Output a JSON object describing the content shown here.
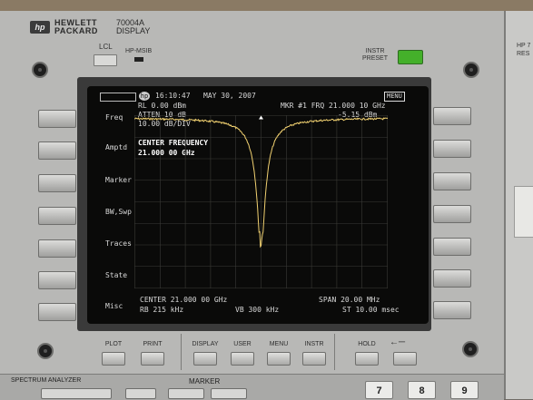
{
  "instrument": {
    "brand_line1": "HEWLETT",
    "brand_line2": "PACKARD",
    "model": "70004A",
    "model_sub": "DISPLAY",
    "hp_logo": "hp",
    "lcl_label": "LCL",
    "hpmsib_label": "HP-MSIB",
    "instr_label_1": "INSTR",
    "instr_label_2": "PRESET",
    "preset_color": "#44b02a",
    "right_unit_label_1": "HP 7",
    "right_unit_label_2": "RES"
  },
  "screen": {
    "hp_glyph": "hp",
    "time": "16:10:47",
    "date": "MAY 30, 2007",
    "menu": "MENU",
    "rl": "RL 0.00 dBm",
    "atten": "ATTEN 10 dB",
    "scale": "10.00 dB/DIV",
    "marker_line": "MKR #1 FRQ 21.000 10 GHz",
    "marker_level": "-5.15 dBm",
    "active_label": "CENTER FREQUENCY",
    "active_value": "21.000 00 GHz",
    "center": "CENTER 21.000 00 GHz",
    "span": "SPAN 20.00 MHz",
    "rb": "RB 215 kHz",
    "vb": "VB 300 kHz",
    "st": "ST 10.00 msec",
    "trace_color": "#f0d070",
    "graticule_color": "#3a3a36"
  },
  "softkeys_left": [
    {
      "label": "Freq"
    },
    {
      "label": "Amptd"
    },
    {
      "label": "Marker"
    },
    {
      "label": "BW,Swp"
    },
    {
      "label": "Traces"
    },
    {
      "label": "State"
    },
    {
      "label": "Misc"
    }
  ],
  "bottom_buttons": [
    {
      "label": "PLOT"
    },
    {
      "label": "PRINT"
    },
    {
      "label": "DISPLAY"
    },
    {
      "label": "USER"
    },
    {
      "label": "MENU"
    },
    {
      "label": "INSTR"
    },
    {
      "label": "HOLD"
    }
  ],
  "lower_panel": {
    "spectrum_label": "SPECTRUM ANALYZER",
    "marker_label": "MARKER",
    "keys": [
      {
        "label": "7"
      },
      {
        "label": "8"
      },
      {
        "label": "9"
      }
    ]
  }
}
